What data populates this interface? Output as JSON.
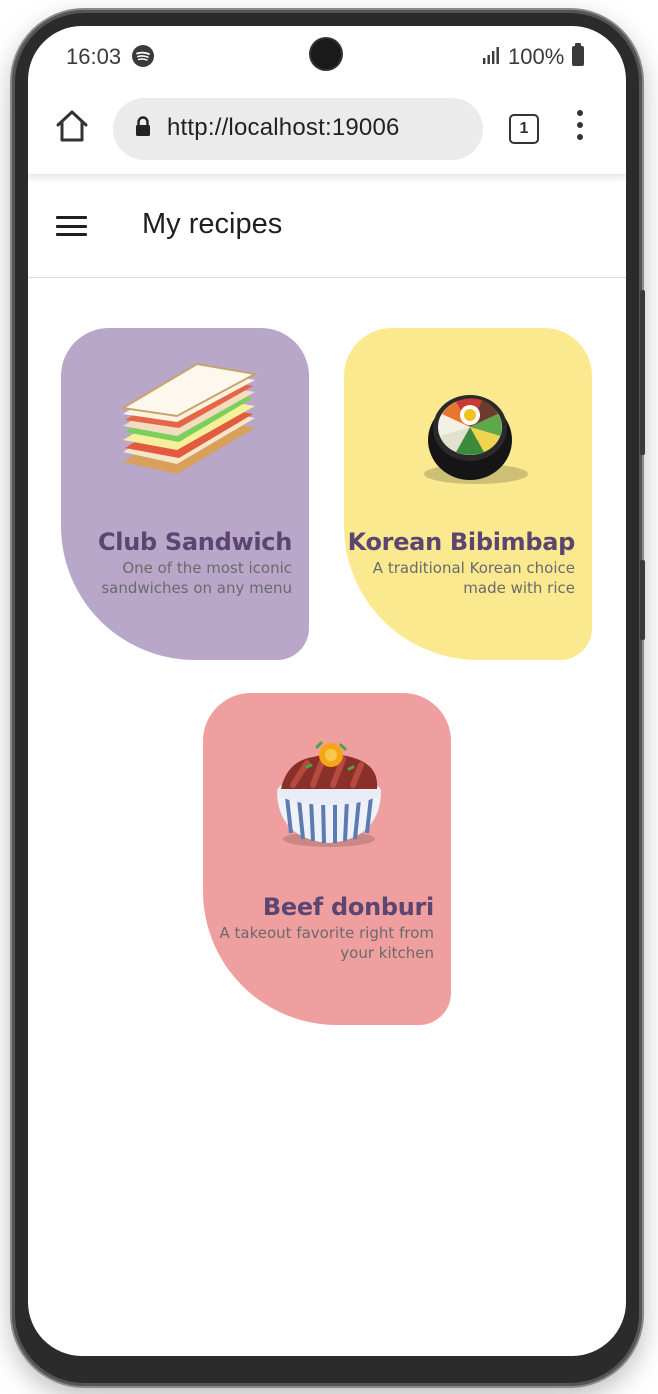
{
  "status_bar": {
    "time": "16:03",
    "battery": "100%",
    "icons": [
      "spotify-icon",
      "signal-icon",
      "battery-icon"
    ]
  },
  "browser": {
    "url": "http://localhost:19006",
    "tab_count": "1",
    "icons": [
      "home-icon",
      "lock-icon",
      "tabs-icon",
      "more-vert-icon"
    ]
  },
  "app_bar": {
    "title": "My recipes",
    "icons": [
      "menu-icon"
    ]
  },
  "recipes": [
    {
      "title": "Club Sandwich",
      "description": "One of the most iconic sandwiches on any menu",
      "color": "#b8a7c9",
      "image": "club-sandwich-image"
    },
    {
      "title": "Korean Bibimbap",
      "description": "A traditional Korean choice made with rice",
      "color": "#fbe990",
      "image": "bibimbap-image"
    },
    {
      "title": "Beef donburi",
      "description": "A takeout favorite right from your kitchen",
      "color": "#ef9f9f",
      "image": "beef-donburi-image"
    }
  ]
}
